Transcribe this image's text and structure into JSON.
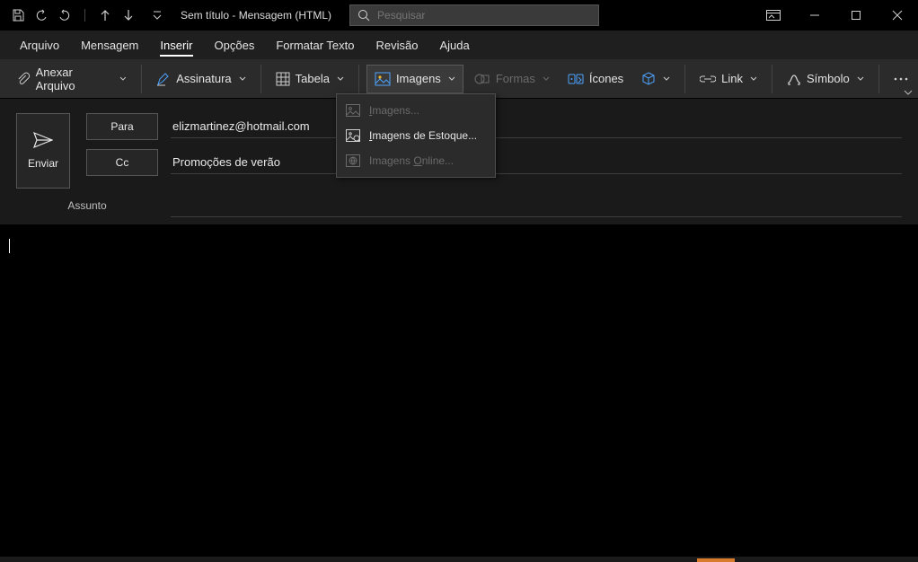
{
  "title": "Sem título  -  Mensagem (HTML)",
  "search": {
    "placeholder": "Pesquisar"
  },
  "tabs": {
    "file": "Arquivo",
    "message": "Mensagem",
    "insert": "Inserir",
    "options": "Opções",
    "format_text": "Formatar Texto",
    "review": "Revisão",
    "help": "Ajuda"
  },
  "ribbon": {
    "attach_file": "Anexar Arquivo",
    "signature": "Assinatura",
    "table": "Tabela",
    "images": "Imagens",
    "shapes": "Formas",
    "icons": "Ícones",
    "link": "Link",
    "symbol": "Símbolo"
  },
  "images_menu": {
    "images": "magens...",
    "images_prefix": "I",
    "stock_prefix": "I",
    "stock": "magens de Estoque...",
    "online_prefix": "Imagens ",
    "online_underline": "O",
    "online_suffix": "nline..."
  },
  "compose": {
    "send": "Enviar",
    "to_btn": "Para",
    "cc_btn": "Cc",
    "to_value": "elizmartinez@hotmail.com",
    "cc_value": "Promoções de verão",
    "subject_label": "Assunto",
    "subject_value": ""
  }
}
